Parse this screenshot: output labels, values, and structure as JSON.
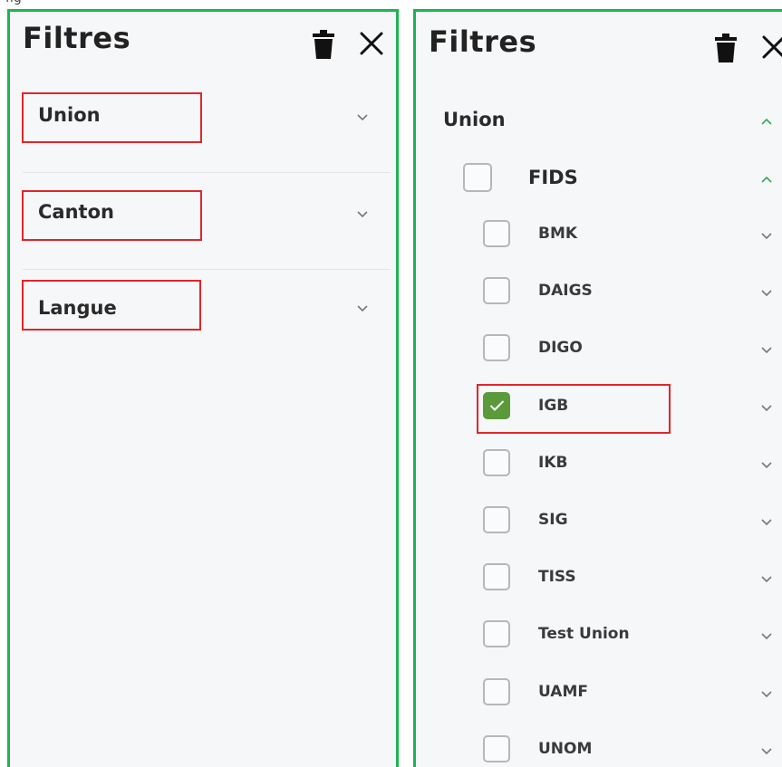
{
  "left_panel": {
    "title": "Filtres",
    "sections": [
      {
        "label": "Union"
      },
      {
        "label": "Canton"
      },
      {
        "label": "Langue"
      }
    ]
  },
  "right_panel": {
    "title": "Filtres",
    "union_label": "Union",
    "group_label": "FIDS",
    "items": [
      {
        "label": "BMK",
        "checked": false
      },
      {
        "label": "DAIGS",
        "checked": false
      },
      {
        "label": "DIGO",
        "checked": false
      },
      {
        "label": "IGB",
        "checked": true
      },
      {
        "label": "IKB",
        "checked": false
      },
      {
        "label": "SIG",
        "checked": false
      },
      {
        "label": "TISS",
        "checked": false
      },
      {
        "label": "Test Union",
        "checked": false
      },
      {
        "label": "UAMF",
        "checked": false
      },
      {
        "label": "UNOM",
        "checked": false
      }
    ]
  },
  "colors": {
    "panel_border": "#1db354",
    "highlight_box": "#e0262a",
    "check_fill": "#5a9a3a",
    "expand_up_chevron": "#3aa655"
  },
  "icons": {
    "delete": "trash-icon",
    "close": "close-icon",
    "collapsed": "chevron-down-icon",
    "expanded": "chevron-up-icon",
    "checked": "checkmark-icon"
  }
}
